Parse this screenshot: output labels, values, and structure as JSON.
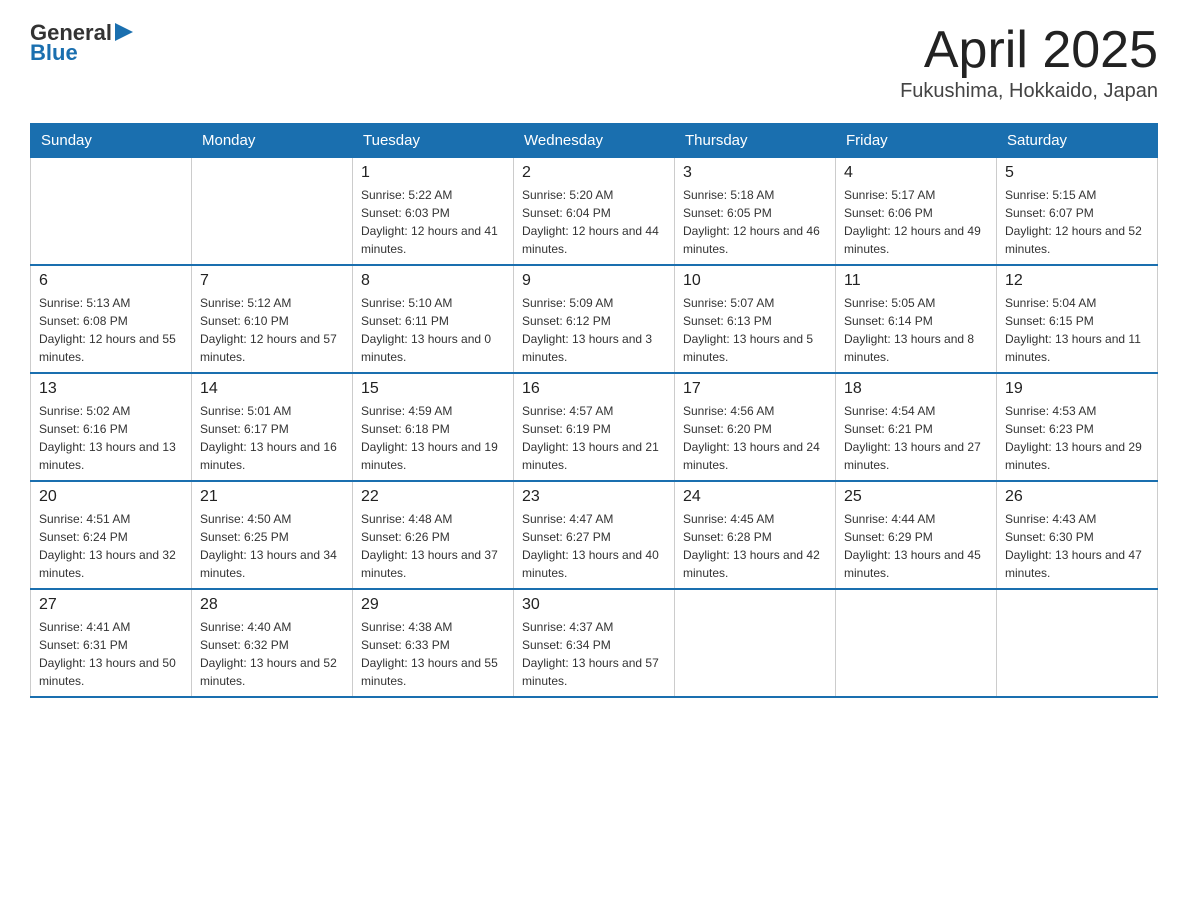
{
  "logo": {
    "general": "General",
    "arrow": "▶",
    "blue": "Blue"
  },
  "title": "April 2025",
  "subtitle": "Fukushima, Hokkaido, Japan",
  "weekdays": [
    "Sunday",
    "Monday",
    "Tuesday",
    "Wednesday",
    "Thursday",
    "Friday",
    "Saturday"
  ],
  "weeks": [
    [
      {
        "day": "",
        "sunrise": "",
        "sunset": "",
        "daylight": ""
      },
      {
        "day": "",
        "sunrise": "",
        "sunset": "",
        "daylight": ""
      },
      {
        "day": "1",
        "sunrise": "Sunrise: 5:22 AM",
        "sunset": "Sunset: 6:03 PM",
        "daylight": "Daylight: 12 hours and 41 minutes."
      },
      {
        "day": "2",
        "sunrise": "Sunrise: 5:20 AM",
        "sunset": "Sunset: 6:04 PM",
        "daylight": "Daylight: 12 hours and 44 minutes."
      },
      {
        "day": "3",
        "sunrise": "Sunrise: 5:18 AM",
        "sunset": "Sunset: 6:05 PM",
        "daylight": "Daylight: 12 hours and 46 minutes."
      },
      {
        "day": "4",
        "sunrise": "Sunrise: 5:17 AM",
        "sunset": "Sunset: 6:06 PM",
        "daylight": "Daylight: 12 hours and 49 minutes."
      },
      {
        "day": "5",
        "sunrise": "Sunrise: 5:15 AM",
        "sunset": "Sunset: 6:07 PM",
        "daylight": "Daylight: 12 hours and 52 minutes."
      }
    ],
    [
      {
        "day": "6",
        "sunrise": "Sunrise: 5:13 AM",
        "sunset": "Sunset: 6:08 PM",
        "daylight": "Daylight: 12 hours and 55 minutes."
      },
      {
        "day": "7",
        "sunrise": "Sunrise: 5:12 AM",
        "sunset": "Sunset: 6:10 PM",
        "daylight": "Daylight: 12 hours and 57 minutes."
      },
      {
        "day": "8",
        "sunrise": "Sunrise: 5:10 AM",
        "sunset": "Sunset: 6:11 PM",
        "daylight": "Daylight: 13 hours and 0 minutes."
      },
      {
        "day": "9",
        "sunrise": "Sunrise: 5:09 AM",
        "sunset": "Sunset: 6:12 PM",
        "daylight": "Daylight: 13 hours and 3 minutes."
      },
      {
        "day": "10",
        "sunrise": "Sunrise: 5:07 AM",
        "sunset": "Sunset: 6:13 PM",
        "daylight": "Daylight: 13 hours and 5 minutes."
      },
      {
        "day": "11",
        "sunrise": "Sunrise: 5:05 AM",
        "sunset": "Sunset: 6:14 PM",
        "daylight": "Daylight: 13 hours and 8 minutes."
      },
      {
        "day": "12",
        "sunrise": "Sunrise: 5:04 AM",
        "sunset": "Sunset: 6:15 PM",
        "daylight": "Daylight: 13 hours and 11 minutes."
      }
    ],
    [
      {
        "day": "13",
        "sunrise": "Sunrise: 5:02 AM",
        "sunset": "Sunset: 6:16 PM",
        "daylight": "Daylight: 13 hours and 13 minutes."
      },
      {
        "day": "14",
        "sunrise": "Sunrise: 5:01 AM",
        "sunset": "Sunset: 6:17 PM",
        "daylight": "Daylight: 13 hours and 16 minutes."
      },
      {
        "day": "15",
        "sunrise": "Sunrise: 4:59 AM",
        "sunset": "Sunset: 6:18 PM",
        "daylight": "Daylight: 13 hours and 19 minutes."
      },
      {
        "day": "16",
        "sunrise": "Sunrise: 4:57 AM",
        "sunset": "Sunset: 6:19 PM",
        "daylight": "Daylight: 13 hours and 21 minutes."
      },
      {
        "day": "17",
        "sunrise": "Sunrise: 4:56 AM",
        "sunset": "Sunset: 6:20 PM",
        "daylight": "Daylight: 13 hours and 24 minutes."
      },
      {
        "day": "18",
        "sunrise": "Sunrise: 4:54 AM",
        "sunset": "Sunset: 6:21 PM",
        "daylight": "Daylight: 13 hours and 27 minutes."
      },
      {
        "day": "19",
        "sunrise": "Sunrise: 4:53 AM",
        "sunset": "Sunset: 6:23 PM",
        "daylight": "Daylight: 13 hours and 29 minutes."
      }
    ],
    [
      {
        "day": "20",
        "sunrise": "Sunrise: 4:51 AM",
        "sunset": "Sunset: 6:24 PM",
        "daylight": "Daylight: 13 hours and 32 minutes."
      },
      {
        "day": "21",
        "sunrise": "Sunrise: 4:50 AM",
        "sunset": "Sunset: 6:25 PM",
        "daylight": "Daylight: 13 hours and 34 minutes."
      },
      {
        "day": "22",
        "sunrise": "Sunrise: 4:48 AM",
        "sunset": "Sunset: 6:26 PM",
        "daylight": "Daylight: 13 hours and 37 minutes."
      },
      {
        "day": "23",
        "sunrise": "Sunrise: 4:47 AM",
        "sunset": "Sunset: 6:27 PM",
        "daylight": "Daylight: 13 hours and 40 minutes."
      },
      {
        "day": "24",
        "sunrise": "Sunrise: 4:45 AM",
        "sunset": "Sunset: 6:28 PM",
        "daylight": "Daylight: 13 hours and 42 minutes."
      },
      {
        "day": "25",
        "sunrise": "Sunrise: 4:44 AM",
        "sunset": "Sunset: 6:29 PM",
        "daylight": "Daylight: 13 hours and 45 minutes."
      },
      {
        "day": "26",
        "sunrise": "Sunrise: 4:43 AM",
        "sunset": "Sunset: 6:30 PM",
        "daylight": "Daylight: 13 hours and 47 minutes."
      }
    ],
    [
      {
        "day": "27",
        "sunrise": "Sunrise: 4:41 AM",
        "sunset": "Sunset: 6:31 PM",
        "daylight": "Daylight: 13 hours and 50 minutes."
      },
      {
        "day": "28",
        "sunrise": "Sunrise: 4:40 AM",
        "sunset": "Sunset: 6:32 PM",
        "daylight": "Daylight: 13 hours and 52 minutes."
      },
      {
        "day": "29",
        "sunrise": "Sunrise: 4:38 AM",
        "sunset": "Sunset: 6:33 PM",
        "daylight": "Daylight: 13 hours and 55 minutes."
      },
      {
        "day": "30",
        "sunrise": "Sunrise: 4:37 AM",
        "sunset": "Sunset: 6:34 PM",
        "daylight": "Daylight: 13 hours and 57 minutes."
      },
      {
        "day": "",
        "sunrise": "",
        "sunset": "",
        "daylight": ""
      },
      {
        "day": "",
        "sunrise": "",
        "sunset": "",
        "daylight": ""
      },
      {
        "day": "",
        "sunrise": "",
        "sunset": "",
        "daylight": ""
      }
    ]
  ]
}
